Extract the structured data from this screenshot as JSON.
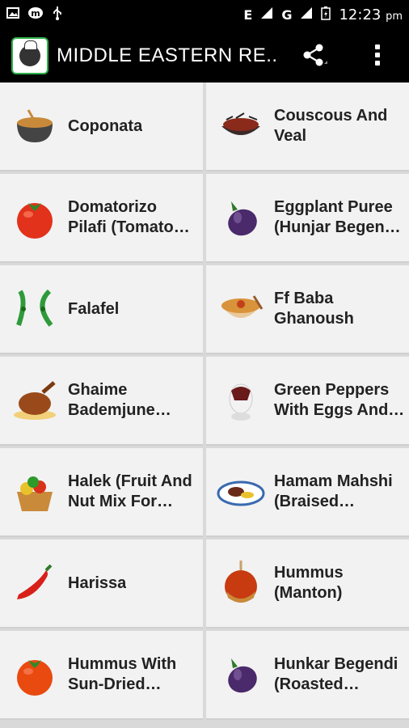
{
  "status": {
    "network": "E",
    "network2": "G",
    "time": "12:23",
    "ampm": "pm"
  },
  "appbar": {
    "title": "MIDDLE EASTERN RE..",
    "icon": "chef-logo-icon"
  },
  "recipes": [
    {
      "name": "Coponata",
      "icon": "soup-pot-icon",
      "color": "#c88a3a"
    },
    {
      "name": "Couscous And Veal",
      "icon": "lobster-bowl-icon",
      "color": "#8a2a1a"
    },
    {
      "name": "Domatorizo Pilafi (Tomato…",
      "icon": "tomato-icon",
      "color": "#e2321b"
    },
    {
      "name": "Eggplant Puree (Hunjar Begen…",
      "icon": "eggplant-icon",
      "color": "#4a2a6a"
    },
    {
      "name": "Falafel",
      "icon": "peas-icon",
      "color": "#2e9a3a"
    },
    {
      "name": "Ff Baba Ghanoush",
      "icon": "bowl-dish-icon",
      "color": "#d9933a"
    },
    {
      "name": "Ghaime Bademjune…",
      "icon": "roast-chicken-icon",
      "color": "#9a4a1a"
    },
    {
      "name": "Green Peppers With Eggs And…",
      "icon": "egg-cup-icon",
      "color": "#6a1a1a"
    },
    {
      "name": "Halek (Fruit And Nut Mix For…",
      "icon": "fruit-basket-icon",
      "color": "#c98a3a"
    },
    {
      "name": "Hamam Mahshi (Braised…",
      "icon": "plate-dish-icon",
      "color": "#3a6ab0"
    },
    {
      "name": "Harissa",
      "icon": "chili-pepper-icon",
      "color": "#d8201a"
    },
    {
      "name": "Hummus (Manton)",
      "icon": "caramel-apple-icon",
      "color": "#c83a10"
    },
    {
      "name": "Hummus With Sun-Dried…",
      "icon": "tomato-icon",
      "color": "#e84a10"
    },
    {
      "name": "Hunkar Begendi (Roasted…",
      "icon": "eggplant-icon",
      "color": "#4a2a6a"
    }
  ]
}
